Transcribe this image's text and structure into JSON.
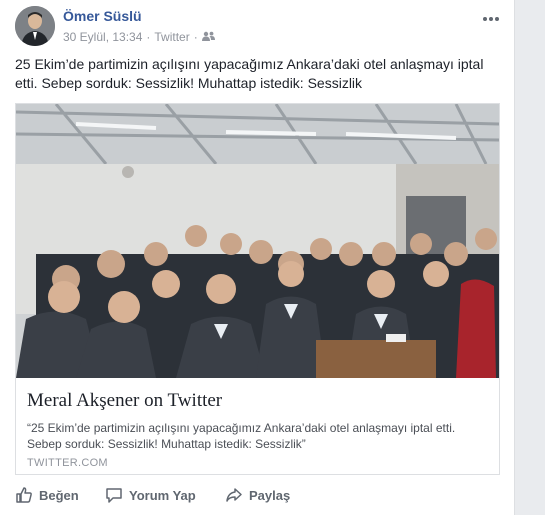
{
  "post": {
    "author": "Ömer Süslü",
    "date": "30 Eylül, 13:34",
    "source": "Twitter",
    "text": "25 Ekim’de partimizin açılışını yapacağımız Ankara’daki otel anlaşmayı iptal etti. Sebep sorduk: Sessizlik! Muhattap istedik: Sessizlik"
  },
  "link": {
    "title": "Meral Akşener on Twitter",
    "description": "“25 Ekim’de partimizin açılışını yapacağımız Ankara’daki otel anlaşmayı iptal etti. Sebep sorduk: Sessizlik! Muhattap istedik: Sessizlik”",
    "domain": "TWITTER.COM"
  },
  "actions": {
    "like": "Beğen",
    "comment": "Yorum Yap",
    "share": "Paylaş"
  },
  "icons": {
    "more": "more-options-icon",
    "audience": "friends-icon",
    "like": "thumbs-up-icon",
    "comment": "comment-icon",
    "share": "share-icon"
  },
  "colors": {
    "author": "#365899",
    "meta": "#90949c",
    "action": "#606770"
  }
}
